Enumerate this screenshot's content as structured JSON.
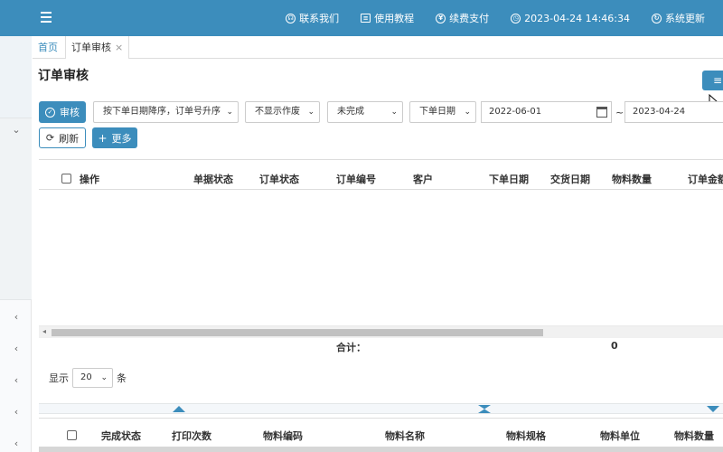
{
  "topbar": {
    "links": [
      {
        "icon": "headset-icon",
        "glyph": "☊",
        "label": "联系我们"
      },
      {
        "icon": "book-icon",
        "glyph": "≡",
        "label": "使用教程"
      },
      {
        "icon": "yen-icon",
        "glyph": "¥",
        "label": "续费支付"
      },
      {
        "icon": "clock-icon",
        "glyph": "◷",
        "label": "2023-04-24 14:46:34"
      },
      {
        "icon": "refresh-icon",
        "glyph": "↻",
        "label": "系统更新"
      }
    ]
  },
  "tabs": {
    "home": "首页",
    "active": "订单审核",
    "close": "×"
  },
  "page": {
    "title": "订单审核"
  },
  "toolbar": {
    "audit_label": "审核",
    "audit_glyph": "✓",
    "refresh_label": "刷新",
    "refresh_glyph": "⟳",
    "more_label": "更多",
    "more_glyph": "+",
    "sort_select": "按下单日期降序，订单号升序",
    "void_select": "不显示作废",
    "status_select": "未完成",
    "date_type_select": "下单日期",
    "date_from": "2022-06-01",
    "date_sep": "~",
    "date_to": "2023-04-24",
    "chevron": "⌄"
  },
  "orders_table": {
    "columns": [
      "操作",
      "单据状态",
      "订单状态",
      "订单编号",
      "客户",
      "下单日期",
      "交货日期",
      "物料数量",
      "订单金额"
    ],
    "totals_label": "合计：",
    "totals_value": "0"
  },
  "pagination": {
    "show_label": "显示",
    "page_size": "20",
    "unit_label": "条"
  },
  "detail_table": {
    "columns": [
      "完成状态",
      "打印次数",
      "物料编码",
      "物料名称",
      "物料规格",
      "物料单位",
      "物料数量"
    ]
  },
  "colors": {
    "primary": "#3c8dbc"
  }
}
